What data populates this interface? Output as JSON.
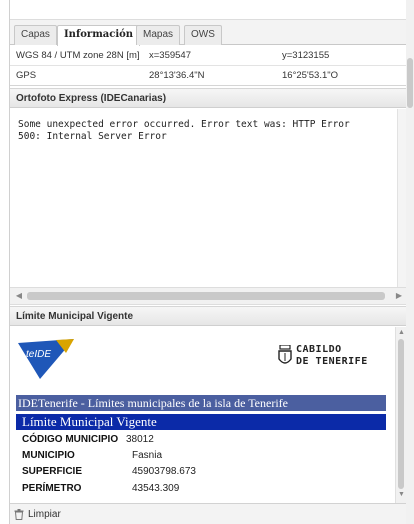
{
  "tabs": [
    {
      "label": "Capas"
    },
    {
      "label": "Información"
    },
    {
      "label": "Mapas"
    },
    {
      "label": "OWS"
    }
  ],
  "coords": {
    "rows": [
      {
        "system": "WGS 84 / UTM zone 28N [m]",
        "x": "x=359547",
        "y": "y=3123155"
      },
      {
        "system": "GPS",
        "x": "28°13'36.4\"N",
        "y": "16°25'53.1\"O"
      }
    ]
  },
  "ortofoto": {
    "title": "Ortofoto Express (IDECanarias)",
    "error_text": "Some unexpected error occurred. Error text was: HTTP Error\n500: Internal Server Error"
  },
  "limite": {
    "title": "Límite Municipal Vigente",
    "logo_teide_text": "teIDE",
    "logo_cabildo_line1": "CABILDO",
    "logo_cabildo_line2": "DE TENERIFE",
    "band1": "IDETenerife - Límites municipales de la isla de Tenerife",
    "band2": "Límite Municipal Vigente",
    "fields": [
      {
        "key": "CÓDIGO MUNICIPIO",
        "value": "38012"
      },
      {
        "key": "MUNICIPIO",
        "value": "Fasnia"
      },
      {
        "key": "SUPERFICIE",
        "value": "45903798.673"
      },
      {
        "key": "PERÍMETRO",
        "value": "43543.309"
      }
    ]
  },
  "footer": {
    "clear_label": "Limpiar"
  },
  "icons": {
    "trash": "trash-icon",
    "teide_logo": "teide-logo",
    "cabildo_crest": "cabildo-crest-icon"
  },
  "colors": {
    "band1": "#4b5fa0",
    "band2": "#0b2aa8",
    "teide_blue": "#1f57b8"
  }
}
